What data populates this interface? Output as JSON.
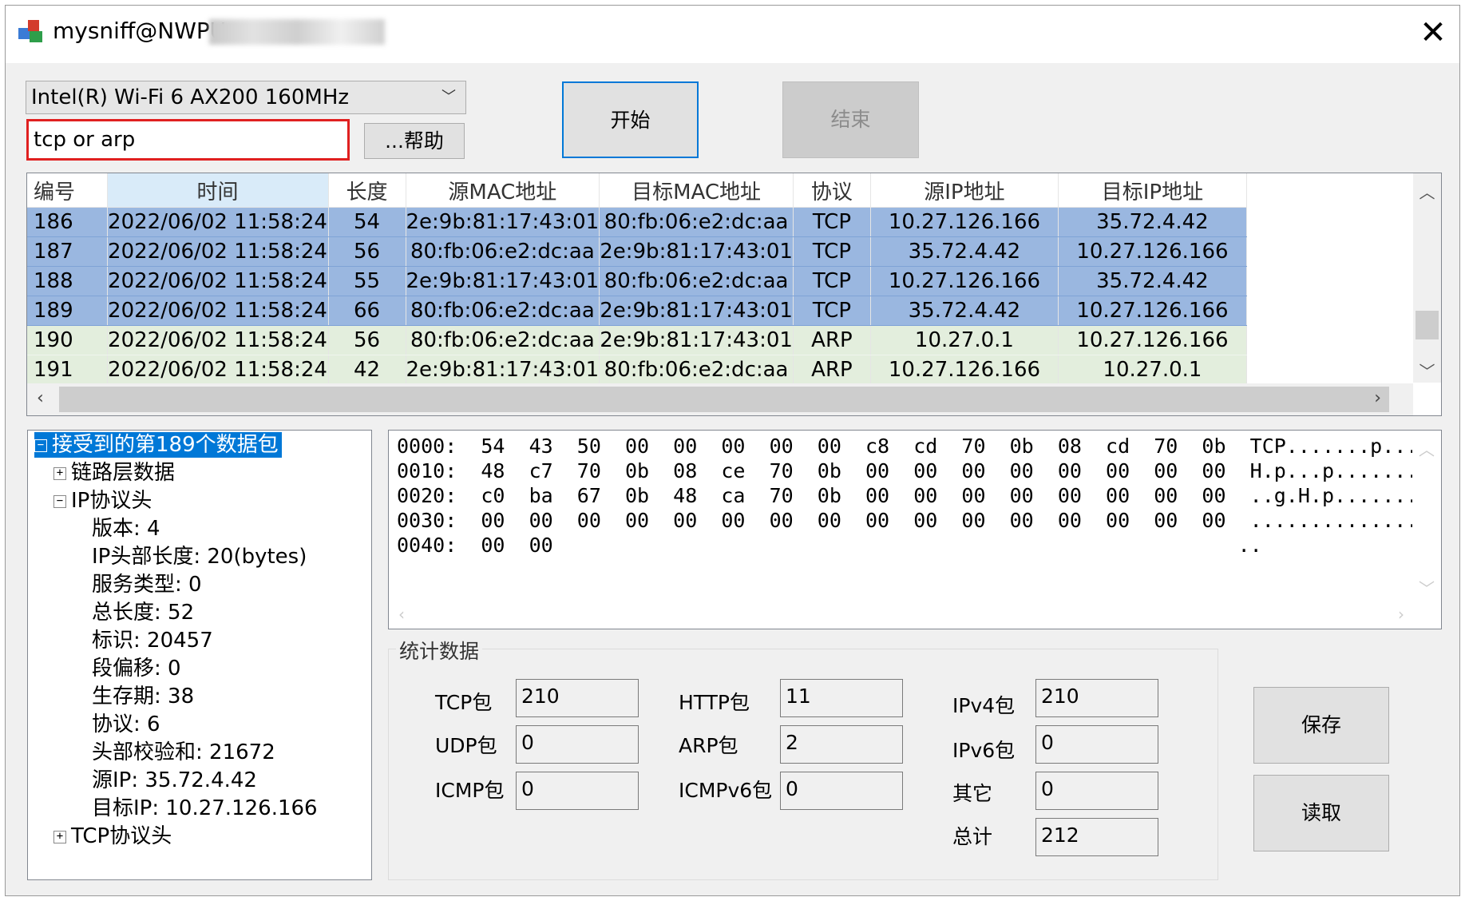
{
  "window": {
    "title": "mysniff@NWPU"
  },
  "controls": {
    "adapter": "Intel(R) Wi-Fi 6 AX200 160MHz",
    "filter_value": "tcp or arp",
    "help_label": "...帮助",
    "start_label": "开始",
    "stop_label": "结束",
    "save_label": "保存",
    "load_label": "读取"
  },
  "packet_list": {
    "columns": [
      "编号",
      "时间",
      "长度",
      "源MAC地址",
      "目标MAC地址",
      "协议",
      "源IP地址",
      "目标IP地址"
    ],
    "rows": [
      {
        "no": "186",
        "time": "2022/06/02 11:58:24",
        "len": "54",
        "src_mac": "2e:9b:81:17:43:01",
        "dst_mac": "80:fb:06:e2:dc:aa",
        "proto": "TCP",
        "src_ip": "10.27.126.166",
        "dst_ip": "35.72.4.42",
        "style": "sel"
      },
      {
        "no": "187",
        "time": "2022/06/02 11:58:24",
        "len": "56",
        "src_mac": "80:fb:06:e2:dc:aa",
        "dst_mac": "2e:9b:81:17:43:01",
        "proto": "TCP",
        "src_ip": "35.72.4.42",
        "dst_ip": "10.27.126.166",
        "style": "sel"
      },
      {
        "no": "188",
        "time": "2022/06/02 11:58:24",
        "len": "55",
        "src_mac": "2e:9b:81:17:43:01",
        "dst_mac": "80:fb:06:e2:dc:aa",
        "proto": "TCP",
        "src_ip": "10.27.126.166",
        "dst_ip": "35.72.4.42",
        "style": "sel"
      },
      {
        "no": "189",
        "time": "2022/06/02 11:58:24",
        "len": "66",
        "src_mac": "80:fb:06:e2:dc:aa",
        "dst_mac": "2e:9b:81:17:43:01",
        "proto": "TCP",
        "src_ip": "35.72.4.42",
        "dst_ip": "10.27.126.166",
        "style": "sel"
      },
      {
        "no": "190",
        "time": "2022/06/02 11:58:24",
        "len": "56",
        "src_mac": "80:fb:06:e2:dc:aa",
        "dst_mac": "2e:9b:81:17:43:01",
        "proto": "ARP",
        "src_ip": "10.27.0.1",
        "dst_ip": "10.27.126.166",
        "style": "arp"
      },
      {
        "no": "191",
        "time": "2022/06/02 11:58:24",
        "len": "42",
        "src_mac": "2e:9b:81:17:43:01",
        "dst_mac": "80:fb:06:e2:dc:aa",
        "proto": "ARP",
        "src_ip": "10.27.126.166",
        "dst_ip": "10.27.0.1",
        "style": "arp"
      }
    ]
  },
  "tree": {
    "root": "接受到的第189个数据包",
    "link": "链路层数据",
    "ip": "IP协议头",
    "fields": [
      "版本: 4",
      "IP头部长度: 20(bytes)",
      "服务类型: 0",
      "总长度: 52",
      "标识: 20457",
      "段偏移: 0",
      "生存期: 38",
      "协议: 6",
      "头部校验和: 21672",
      "源IP: 35.72.4.42",
      "目标IP: 10.27.126.166"
    ],
    "tcp": "TCP协议头"
  },
  "hexdump": [
    "0000:  54  43  50  00  00  00  00  00  c8  cd  70  0b  08  cd  70  0b  TCP.......p...p.",
    "0010:  48  c7  70  0b  08  ce  70  0b  00  00  00  00  00  00  00  00  H.p...p.........",
    "0020:  c0  ba  67  0b  48  ca  70  0b  00  00  00  00  00  00  00  00  ..g.H.p.........",
    "0030:  00  00  00  00  00  00  00  00  00  00  00  00  00  00  00  00  ................",
    "0040:  00  00                                                         .."
  ],
  "stats": {
    "title": "统计数据",
    "tcp_label": "TCP包",
    "tcp": "210",
    "udp_label": "UDP包",
    "udp": "0",
    "icmp_label": "ICMP包",
    "icmp": "0",
    "http_label": "HTTP包",
    "http": "11",
    "arp_label": "ARP包",
    "arp": "2",
    "icmpv6_label": "ICMPv6包",
    "icmpv6": "0",
    "ipv4_label": "IPv4包",
    "ipv4": "210",
    "ipv6_label": "IPv6包",
    "ipv6": "0",
    "other_label": "其它",
    "other": "0",
    "total_label": "总计",
    "total": "212"
  }
}
